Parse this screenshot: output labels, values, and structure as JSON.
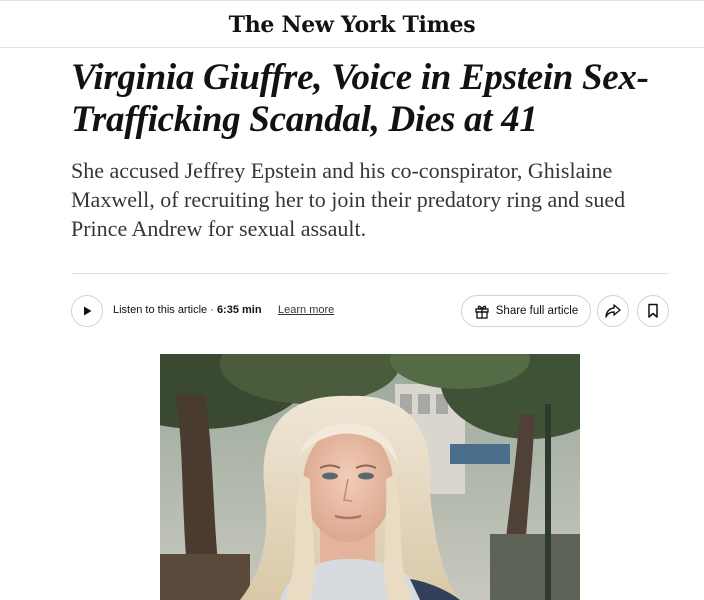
{
  "masthead": {
    "title": "The New York Times"
  },
  "article": {
    "headline": "Virginia Giuffre, Voice in Epstein Sex-Trafficking Scandal, Dies at 41",
    "summary": "She accused Jeffrey Epstein and his co-conspirator, Ghislaine Maxwell, of recruiting her to join their predatory ring and sued Prince Andrew for sexual assault."
  },
  "toolbar": {
    "play_icon": "play-icon",
    "listen_label": "Listen to this article",
    "separator": " · ",
    "duration": "6:35 min",
    "learn_more": "Learn more",
    "share_label": "Share full article",
    "share_icon": "gift-icon",
    "forward_icon": "share-arrow-icon",
    "bookmark_icon": "bookmark-icon"
  },
  "photo": {
    "subject": "photo-of-woman-with-blonde-hair-outdoors"
  }
}
